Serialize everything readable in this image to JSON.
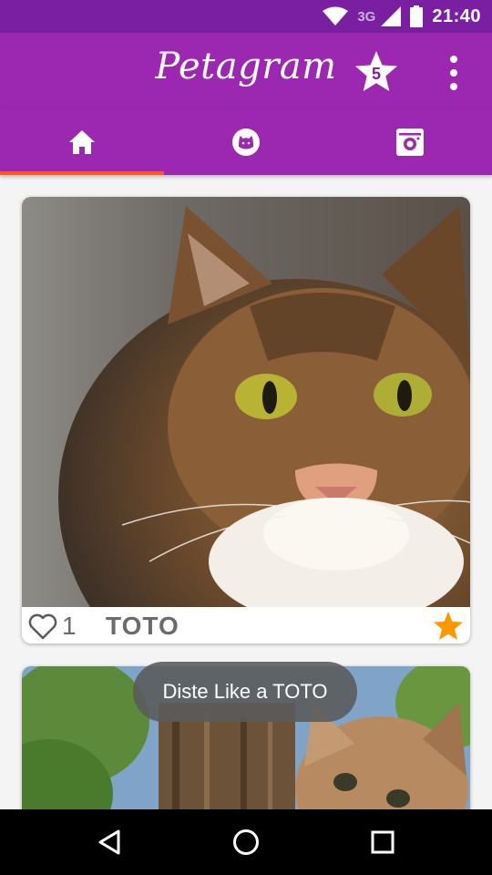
{
  "status_bar": {
    "network": "3G",
    "time": "21:40",
    "icons": [
      "wifi-icon",
      "signal-icon",
      "battery-icon"
    ]
  },
  "app_bar": {
    "title": "Petagram",
    "favorites_count": "5",
    "icons": [
      "star-icon",
      "overflow-menu-icon"
    ]
  },
  "tabs": [
    {
      "name": "home",
      "icon": "home-icon",
      "selected": true
    },
    {
      "name": "pet-profile",
      "icon": "cat-face-icon",
      "selected": false
    },
    {
      "name": "camera",
      "icon": "camera-icon",
      "selected": false
    }
  ],
  "colors": {
    "status_bar": "#7b1fa2",
    "primary": "#9c27b0",
    "tab_indicator": "#ff5722",
    "rating_star": "#ff9800"
  },
  "pets": [
    {
      "name": "TOTO",
      "likes": "1",
      "photo": "tabby-cat-photo"
    },
    {
      "name": "",
      "likes": "",
      "photo": "kitten-tree-photo"
    }
  ],
  "toast": {
    "message": "Diste Like a TOTO"
  },
  "nav_bar": {
    "icons": [
      "back-icon",
      "home-circle-icon",
      "recents-icon"
    ]
  }
}
